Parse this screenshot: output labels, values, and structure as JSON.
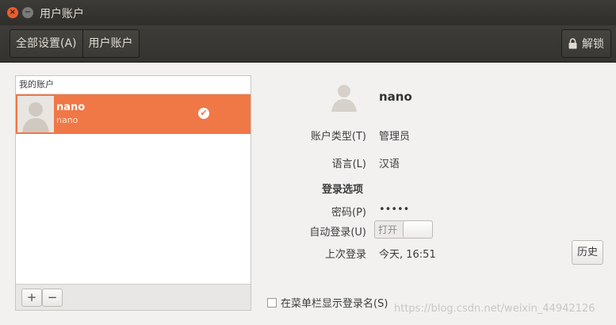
{
  "window": {
    "title": "用户账户",
    "close_glyph": "×",
    "minimize_glyph": "−"
  },
  "toolbar": {
    "breadcrumbs": [
      "全部设置(A)",
      "用户账户"
    ],
    "unlock_label": "解锁"
  },
  "account_list": {
    "header": "我的账户",
    "users": [
      {
        "name": "nano",
        "login": "nano",
        "selected": true,
        "current_user_badge": "✔"
      }
    ],
    "add_label": "+",
    "remove_label": "−"
  },
  "details": {
    "name": "nano",
    "account_type_label": "账户类型(T)",
    "account_type_value": "管理员",
    "language_label": "语言(L)",
    "language_value": "汉语",
    "login_options_title": "登录选项",
    "password_label": "密码(P)",
    "password_value": "•••••",
    "auto_login_label": "自动登录(U)",
    "auto_login_state": "打开",
    "last_login_label": "上次登录",
    "last_login_value": "今天, 16:51",
    "history_button": "历史",
    "show_login_name_label": "在菜单栏显示登录名(S)"
  },
  "watermark": "https://blog.csdn.net/weixin_44942126",
  "colors": {
    "accent": "#f07746",
    "titlebar": "#3c3b37",
    "close_button": "#e85f2d",
    "background": "#f2f1f0"
  }
}
